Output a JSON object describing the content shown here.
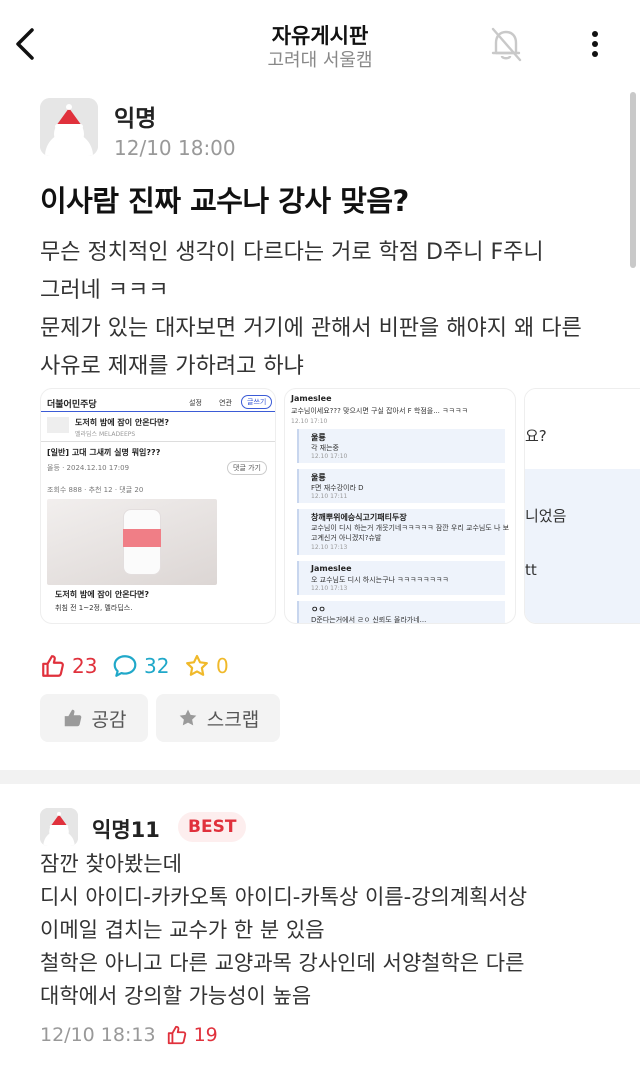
{
  "header": {
    "title": "자유게시판",
    "subtitle": "고려대 서울캠"
  },
  "post": {
    "author": "익명",
    "time": "12/10 18:00",
    "title": "이사람 진짜 교수나 강사 맞음?",
    "body_lines": [
      "무슨 정치적인 생각이 다르다는 거로 학점 D주니 F주니",
      "그러네 ㅋㅋㅋ",
      "문제가 있는 대자보면 거기에 관해서 비판을 해야지 왜 다른",
      "사유로 제재를 가하려고 하냐"
    ],
    "likes": "23",
    "comments": "32",
    "scraps": "0",
    "like_button": "공감",
    "scrap_button": "스크랩"
  },
  "images": {
    "shot1": {
      "board": "더불어민주당",
      "setting": "설정",
      "related": "연관",
      "write": "글쓰기",
      "ad_title": "도저히 밤에 잠이 안온다면?",
      "ad_source": "멜라딥스 MELADEEPS",
      "post_title": "[일반] 고대 그새끼 실명 뭐임???",
      "post_meta": "올등 · 2024.12.10 17:09",
      "reply_btn": "댓글 가기",
      "views": "조회수 888 · 추천 12 · 댓글 20",
      "ad_big": "도저히 밤에 잠이 안온다면?",
      "ad_sub": "취침 전 1~2정, 멜라딥스."
    },
    "shot2": {
      "lines": [
        "Jameslee",
        "교수님이세요??? 맞으시면 구실 잡아서 F 학점을... ㅋㅋㅋㅋ",
        "12.10 17:10",
        "울룡",
        "각 재는중",
        "12.10 17:10",
        "울룡",
        "F면 재수강이라 D",
        "12.10 17:11",
        "창깨뿌위에승식고기패티두장",
        "교수님이 디시 하는거 개웃기네ㅋㅋㅋㅋㅋ 잠깐 우리 교수님도 나 보",
        "고계신거 아니겠지?슈발",
        "12.10 17:13",
        "Jameslee",
        "오 교수님도 디시 하시는구나 ㅋㅋㅋㅋㅋㅋㅋㅋ",
        "12.10 17:13",
        "ㅇㅇ",
        "D준다는거에서 ㄹㅇ 신뢰도 올라가네..."
      ]
    },
    "shot3": {
      "lines": [
        "요?",
        "니었음",
        "tt"
      ]
    }
  },
  "comment": {
    "author": "익명11",
    "badge": "BEST",
    "body_lines": [
      "잠깐 찾아봤는데",
      "디시 아이디-카카오톡 아이디-카톡상 이름-강의계획서상",
      "이메일 겹치는 교수가 한 분 있음",
      "철학은 아니고 다른 교양과목 강사인데 서양철학은 다른",
      "대학에서 강의할 가능성이 높음"
    ],
    "time": "12/10 18:13",
    "likes": "19"
  },
  "colors": {
    "accent_red": "#e0313c",
    "comment_teal": "#20a8c9",
    "scrap_yellow": "#f0b92a"
  }
}
